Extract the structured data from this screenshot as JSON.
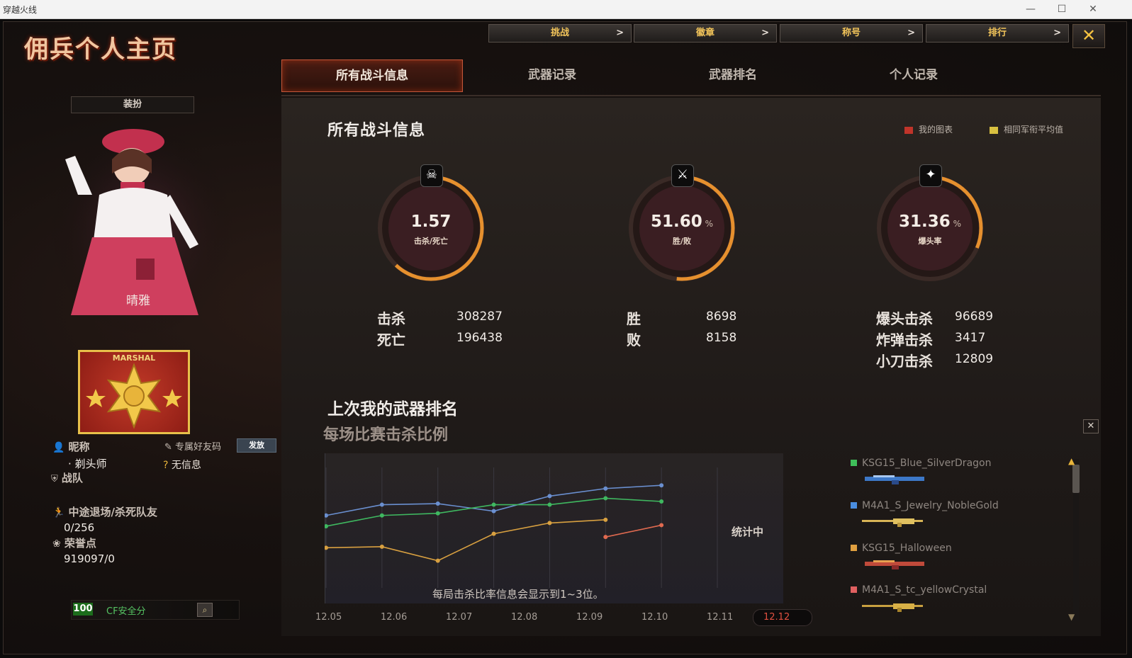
{
  "window": {
    "title": "穿越火线"
  },
  "page": {
    "title": "佣兵个人主页",
    "close_label": "✕"
  },
  "top_nav": [
    {
      "label": "挑战"
    },
    {
      "label": "徽章"
    },
    {
      "label": "称号"
    },
    {
      "label": "排行"
    }
  ],
  "tabs": [
    {
      "label": "所有战斗信息",
      "active": true
    },
    {
      "label": "武器记录",
      "active": false
    },
    {
      "label": "武器排名",
      "active": false
    },
    {
      "label": "个人记录",
      "active": false
    }
  ],
  "profile": {
    "outfit_button": "装扮",
    "character_name": "晴雅",
    "rank_badge": "MARSHAL",
    "nickname_label": "昵称",
    "nickname_value": "· 剃头师",
    "friend_code_label": "专属好友码",
    "friend_code_button": "发放",
    "friend_code_value": "无信息",
    "team_label": "战队",
    "quit_label": "中途退场/杀死队友",
    "quit_value": "0/256",
    "honor_label": "荣誉点",
    "honor_value": "919097/0",
    "safety_score": "100",
    "safety_label": "CF安全分"
  },
  "combat": {
    "title": "所有战斗信息",
    "legend": [
      {
        "label": "我的图表",
        "color": "#c0342a"
      },
      {
        "label": "相同军衔平均值",
        "color": "#d8c040"
      }
    ],
    "rings": [
      {
        "value": "1.57",
        "unit": "",
        "label": "击杀/死亡",
        "fill": 0.62,
        "icon": "skull-icon"
      },
      {
        "value": "51.60",
        "unit": "%",
        "label": "胜/败",
        "fill": 0.516,
        "icon": "crossed-swords-icon"
      },
      {
        "value": "31.36",
        "unit": "%",
        "label": "爆头率",
        "fill": 0.3136,
        "icon": "headshot-icon"
      }
    ],
    "stats": [
      [
        {
          "label": "击杀",
          "value": "308287"
        },
        {
          "label": "死亡",
          "value": "196438"
        }
      ],
      [
        {
          "label": "胜",
          "value": "8698"
        },
        {
          "label": "败",
          "value": "8158"
        }
      ],
      [
        {
          "label": "爆头击杀",
          "value": "96689"
        },
        {
          "label": "炸弹击杀",
          "value": "3417"
        },
        {
          "label": "小刀击杀",
          "value": "12809"
        }
      ]
    ]
  },
  "weapon_rank": {
    "title": "上次我的武器排名",
    "subtitle": "每场比赛击杀比例",
    "stat_note": "统计中",
    "footer_note": "每局击杀比率信息会显示到1~3位。",
    "close_label": "✕",
    "weapons": [
      {
        "name": "KSG15_Blue_SilverDragon",
        "color": "#3fbf5a"
      },
      {
        "name": "M4A1_S_Jewelry_NobleGold",
        "color": "#4a8de0"
      },
      {
        "name": "KSG15_Halloween",
        "color": "#e0a040"
      },
      {
        "name": "M4A1_S_tc_yellowCrystal",
        "color": "#e06060"
      }
    ]
  },
  "chart_data": {
    "type": "line",
    "x": [
      "12.05",
      "12.06",
      "12.07",
      "12.08",
      "12.09",
      "12.10",
      "12.11",
      "12.12"
    ],
    "selected_x": "12.12",
    "series": [
      {
        "color": "#6a8fd0",
        "values": [
          0.62,
          0.72,
          0.73,
          0.66,
          0.8,
          0.87,
          0.9,
          null
        ]
      },
      {
        "color": "#3fb860",
        "values": [
          0.52,
          0.62,
          0.64,
          0.72,
          0.72,
          0.78,
          0.75,
          null
        ]
      },
      {
        "color": "#d8a040",
        "values": [
          0.32,
          0.33,
          0.2,
          0.45,
          0.55,
          0.58,
          null,
          null
        ]
      },
      {
        "color": "#e06a50",
        "values": [
          null,
          null,
          null,
          null,
          null,
          0.42,
          0.53,
          null
        ]
      }
    ],
    "ylim": [
      0,
      1
    ],
    "grid": false
  },
  "colors": {
    "accent": "#c4573a",
    "gold": "#f2c45a",
    "ring_orange": "#e6902e"
  }
}
